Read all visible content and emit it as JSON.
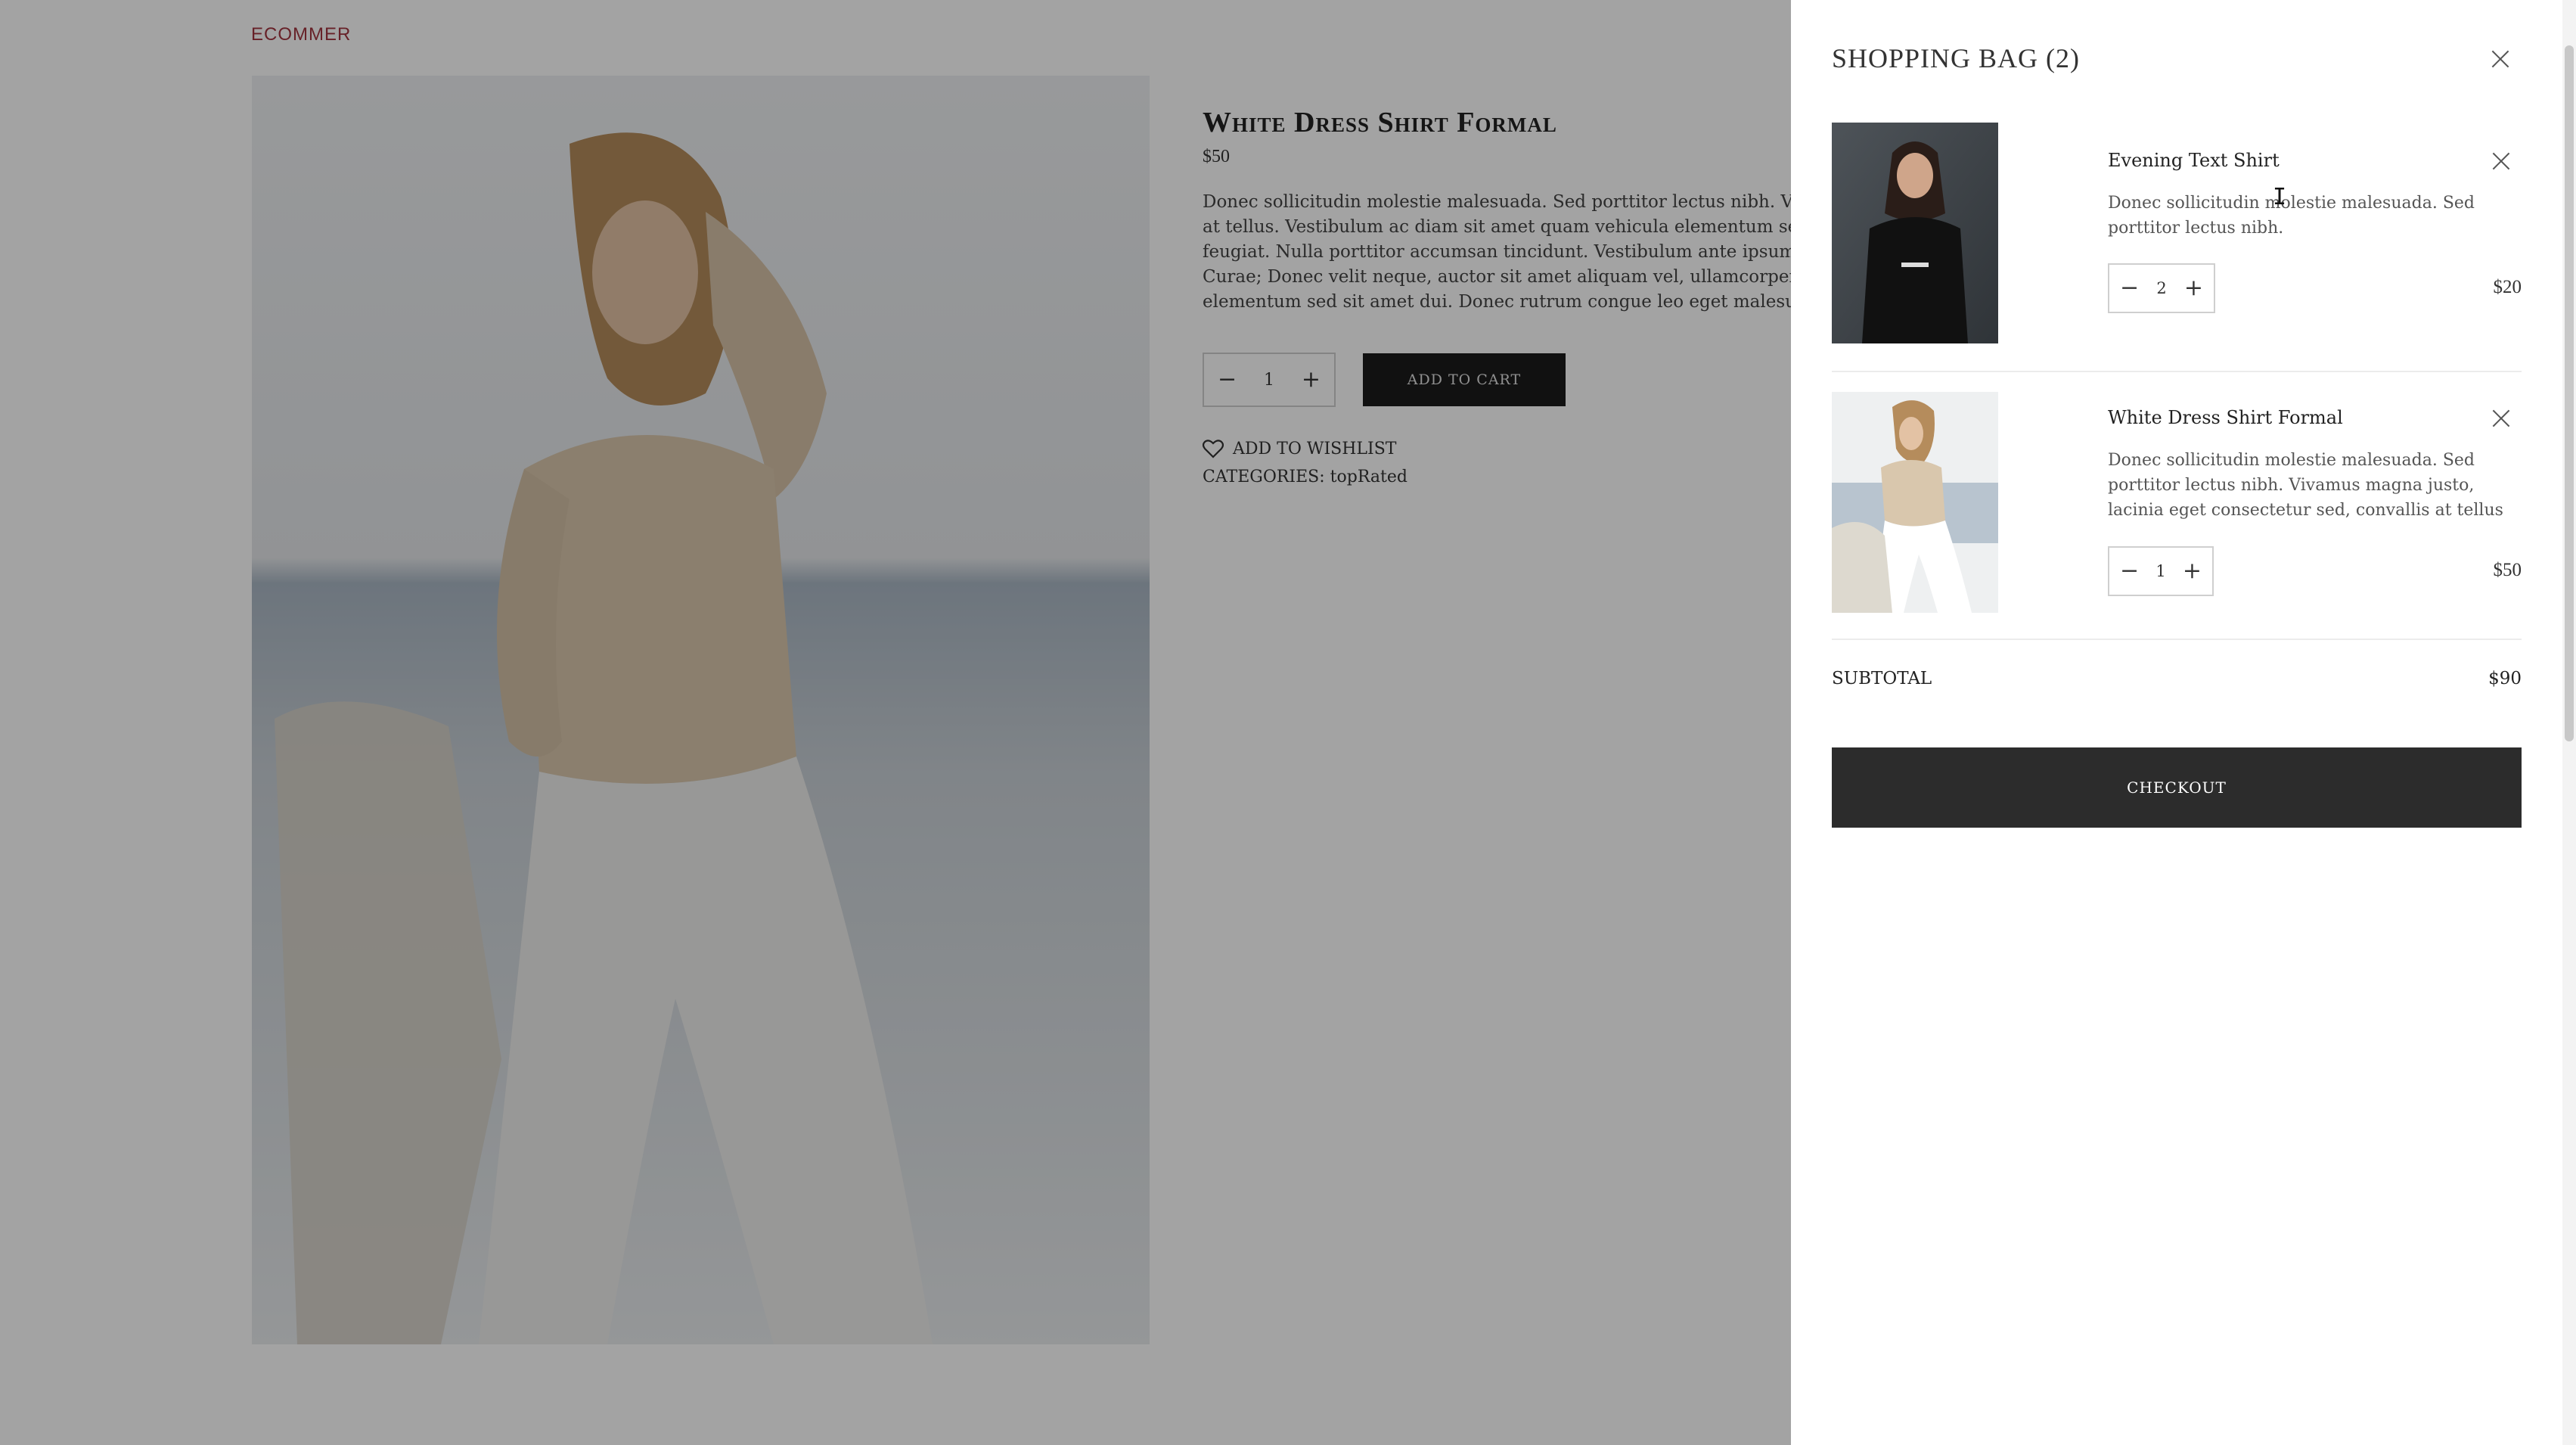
{
  "page": {
    "brand": "ECOMMER",
    "product": {
      "title": "White Dress Shirt Formal",
      "price": "$50",
      "description_lines": [
        "Donec sollicitudin molestie malesuada. Sed porttitor lectus nibh. Viva",
        "at tellus. Vestibulum ac diam sit amet quam vehicula elementum se",
        "feugiat. Nulla porttitor accumsan tincidunt. Vestibulum ante ipsum p",
        "Curae; Donec velit neque, auctor sit amet aliquam vel, ullamcorper s",
        "elementum sed sit amet dui. Donec rutrum congue leo eget malesua"
      ],
      "quantity": "1",
      "add_to_cart_label": "ADD TO CART",
      "wishlist_label": "ADD TO WISHLIST",
      "categories_text": "CATEGORIES: topRated"
    }
  },
  "bag": {
    "title": "SHOPPING BAG (2)",
    "items": [
      {
        "name": "Evening Text Shirt",
        "description": "Donec sollicitudin molestie malesuada. Sed porttitor lectus nibh.",
        "quantity": "2",
        "price": "$20"
      },
      {
        "name": "White Dress Shirt Formal",
        "description": "Donec sollicitudin molestie malesuada. Sed porttitor lectus nibh. Vivamus magna justo, lacinia eget consectetur sed, convallis at tellus",
        "quantity": "1",
        "price": "$50"
      }
    ],
    "subtotal_label": "SUBTOTAL",
    "subtotal_value": "$90",
    "checkout_label": "CHECKOUT"
  },
  "colors": {
    "brand": "#a2353f",
    "dark_button": "#2c2c2c",
    "overlay": "rgba(0,0,0,0.36)"
  },
  "icons": {
    "close": "close-icon",
    "minus": "minus-icon",
    "plus": "plus-icon",
    "heart": "heart-icon"
  }
}
